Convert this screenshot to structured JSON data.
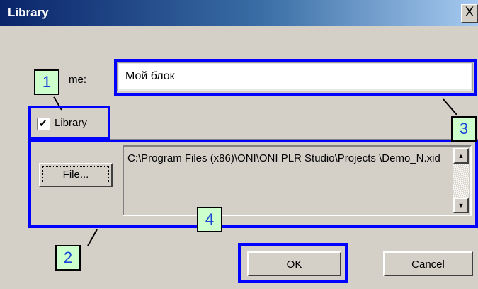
{
  "window": {
    "title": "Library",
    "close_label": "X"
  },
  "form": {
    "name_label": "me:",
    "name_value": "Мой блок",
    "library_checkbox": {
      "label": "Library",
      "checked": true,
      "mark": "✓"
    },
    "file_button": "File...",
    "path": "C:\\Program Files (x86)\\ONI\\ONI PLR Studio\\Projects \\Demo_N.xid",
    "scroll_up": "▲",
    "scroll_down": "▼"
  },
  "buttons": {
    "ok": "OK",
    "cancel": "Cancel"
  },
  "annotations": {
    "color": "#0000ff",
    "callout_fill": "#ccffcc",
    "callouts": [
      "1",
      "2",
      "3",
      "4"
    ]
  }
}
